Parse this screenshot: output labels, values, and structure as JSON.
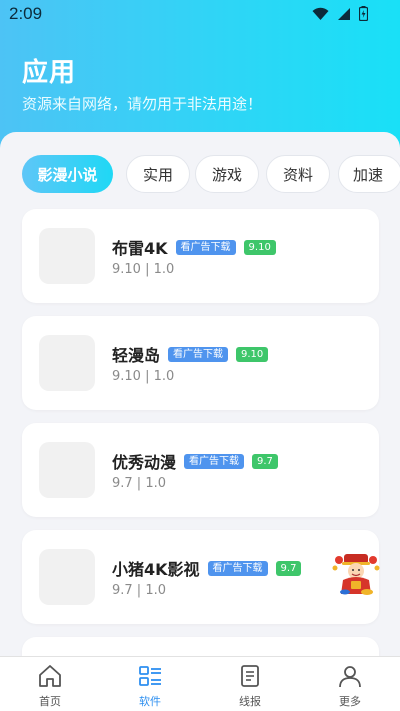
{
  "status": {
    "time": "2:09"
  },
  "header": {
    "title": "应用",
    "subtitle": "资源来自网络，请勿用于非法用途！"
  },
  "categories": [
    {
      "label": "影漫小说",
      "active": true
    },
    {
      "label": "实用",
      "active": false
    },
    {
      "label": "游戏",
      "active": false
    },
    {
      "label": "资料",
      "active": false
    },
    {
      "label": "加速",
      "active": false
    }
  ],
  "apps": [
    {
      "name": "布雷4K",
      "ad_tag": "看广告下载",
      "score": "9.10",
      "meta": "9.10 | 1.0"
    },
    {
      "name": "轻漫岛",
      "ad_tag": "看广告下载",
      "score": "9.10",
      "meta": "9.10 | 1.0"
    },
    {
      "name": "优秀动漫",
      "ad_tag": "看广告下载",
      "score": "9.7",
      "meta": "9.7 | 1.0"
    },
    {
      "name": "小猪4K影视",
      "ad_tag": "看广告下载",
      "score": "9.7",
      "meta": "9.7 | 1.0"
    }
  ],
  "tabbar": [
    {
      "label": "首页",
      "icon": "home-icon",
      "active": false
    },
    {
      "label": "软件",
      "icon": "list-icon",
      "active": true
    },
    {
      "label": "线报",
      "icon": "document-icon",
      "active": false
    },
    {
      "label": "更多",
      "icon": "user-icon",
      "active": false
    }
  ],
  "colors": {
    "accent": "#2d8ff0",
    "ad_tag": "#4f94ee",
    "score_tag": "#3ec66a"
  }
}
